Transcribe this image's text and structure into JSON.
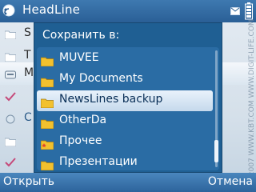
{
  "app": {
    "title": "HeadLine",
    "icon": "rss-globe-icon"
  },
  "status": {
    "icons": [
      "message-envelope-icon",
      "battery-icon"
    ]
  },
  "background_list": {
    "items": [
      {
        "text": "S",
        "icon": "folder-icon"
      },
      {
        "text": "T",
        "icon": "folder-icon"
      },
      {
        "text": "M",
        "icon": "drive-icon"
      },
      {
        "text": "",
        "icon": "check-icon"
      },
      {
        "text": "C",
        "icon": "circle-icon"
      },
      {
        "text": "",
        "icon": "folder-icon"
      },
      {
        "text": "",
        "icon": "check-icon"
      }
    ]
  },
  "dialog": {
    "title": "Сохранить в:",
    "items": [
      {
        "label": "MUVEE",
        "icon": "folder-icon",
        "selected": false
      },
      {
        "label": "My Documents",
        "icon": "folder-icon",
        "selected": false
      },
      {
        "label": "NewsLines backup",
        "icon": "folder-icon",
        "selected": true
      },
      {
        "label": "OtherDa",
        "icon": "folder-icon",
        "selected": false
      },
      {
        "label": "Прочее",
        "icon": "folder-star-icon",
        "selected": false
      },
      {
        "label": "Презентации",
        "icon": "folder-icon",
        "selected": false
      }
    ],
    "scroll_position": 0.75
  },
  "softkeys": {
    "left": "Открыть",
    "right": "Отмена"
  },
  "watermark": "© 2007 WWW.KBT.COM WWW.DIGIT-LIFE.COM",
  "colors": {
    "titlebar": "#2f6aa2",
    "dialog_bg": "#1f5f93",
    "list_bg": "#2a6ca4",
    "selection": "#dce9f6",
    "folder": "#f2c12e"
  }
}
